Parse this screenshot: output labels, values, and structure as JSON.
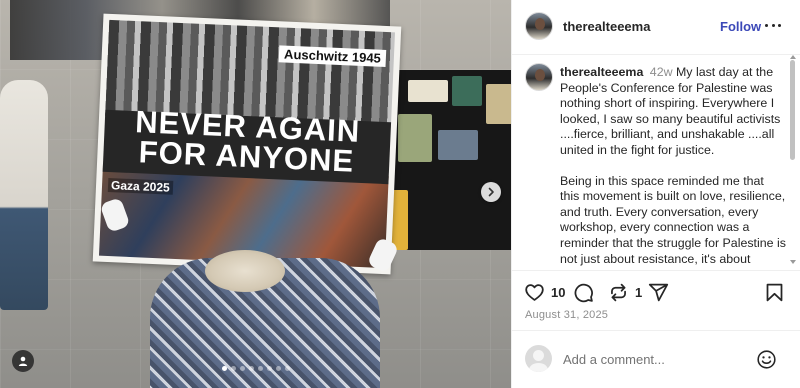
{
  "post": {
    "author": "therealteeema",
    "follow_label": "Follow",
    "age": "42w",
    "caption_paragraphs": [
      "My last day at the People's Conference for Palestine was nothing short of inspiring. Everywhere I looked, I saw so many beautiful activists ....fierce, brilliant, and unshakable ....all united in the fight for justice.",
      "Being in this space reminded me that this movement is built on love, resilience, and truth. Every conversation, every workshop, every connection was a reminder that the struggle for Palestine is not just about resistance, it's about"
    ],
    "likes": "10",
    "reposts": "1",
    "date": "August 31, 2025"
  },
  "photo": {
    "sign_stamp": "Auschwitz 1945",
    "sign_headline": "Never Again For Anyone",
    "sign_caption": "Gaza 2025",
    "slide_count": 8,
    "active_slide": 0
  },
  "comment": {
    "placeholder": "Add a comment..."
  },
  "icons": {
    "like": "heart-icon",
    "comment": "comment-icon",
    "repost": "repost-icon",
    "share": "send-icon",
    "save": "bookmark-icon",
    "emoji": "emoji-icon",
    "next": "chevron-right-icon",
    "tag": "user-tag-icon",
    "more": "more-options-icon"
  },
  "colors": {
    "follow": "#3b48b8",
    "text": "#262626",
    "muted": "#8e8e8e"
  }
}
